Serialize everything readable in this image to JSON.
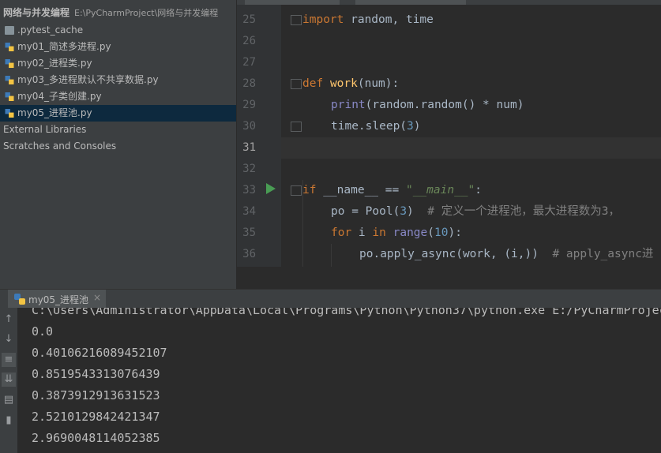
{
  "project": {
    "root_name": "网络与并发编程",
    "root_path": "E:\\PyCharmProject\\网络与并发编程",
    "items": [
      {
        "label": ".pytest_cache",
        "type": "folder"
      },
      {
        "label": "my01_简述多进程.py",
        "type": "py"
      },
      {
        "label": "my02_进程类.py",
        "type": "py"
      },
      {
        "label": "my03_多进程默认不共享数据.py",
        "type": "py"
      },
      {
        "label": "my04_子类创建.py",
        "type": "py"
      },
      {
        "label": "my05_进程池.py",
        "type": "py",
        "selected": true
      }
    ],
    "external_libraries": "External Libraries",
    "scratches": "Scratches and Consoles"
  },
  "editor": {
    "line_numbers": [
      "25",
      "26",
      "27",
      "28",
      "29",
      "30",
      "31",
      "32",
      "33",
      "34",
      "35",
      "36"
    ],
    "current_line": "31",
    "lines": {
      "l25": {
        "kw": "import",
        "rest": " random, time"
      },
      "l28": {
        "kw": "def",
        "fn": "work",
        "rest": "(num):"
      },
      "l29": {
        "bi": "print",
        "rest": "(random.random() * num)"
      },
      "l30": {
        "rest": "time.sleep(",
        "num": "3",
        "close": ")"
      },
      "l33": {
        "kw": "if",
        "mid": " __name__ == ",
        "str": "\"__main__\"",
        "close": ":"
      },
      "l34": {
        "a": "po = Pool(",
        "num": "3",
        "b": ")  ",
        "cm": "# 定义一个进程池，最大进程数为3，"
      },
      "l35": {
        "kw": "for",
        "a": " i ",
        "kw2": "in",
        "bi": " range",
        "b": "(",
        "num": "10",
        "c": "):"
      },
      "l36": {
        "a": "po.apply_async(work, (i,))  ",
        "cm": "# apply_async进"
      }
    }
  },
  "run": {
    "tab_label": "my05_进程池",
    "close": "×",
    "output": [
      "C:\\Users\\Administrator\\AppData\\Local\\Programs\\Python\\Python37\\python.exe E:/PyCharmProjec",
      "0.0",
      "0.40106216089452107",
      "0.8519543313076439",
      "0.3873912913631523",
      "2.5210129842421347",
      "2.9690048114052385"
    ]
  },
  "colors": {
    "keyword": "#cc7832",
    "function": "#ffc66d",
    "builtin": "#8888c6",
    "number": "#6897bb",
    "string": "#6a8759",
    "comment": "#808080",
    "selection": "#0d293e",
    "run_green": "#499c54"
  }
}
